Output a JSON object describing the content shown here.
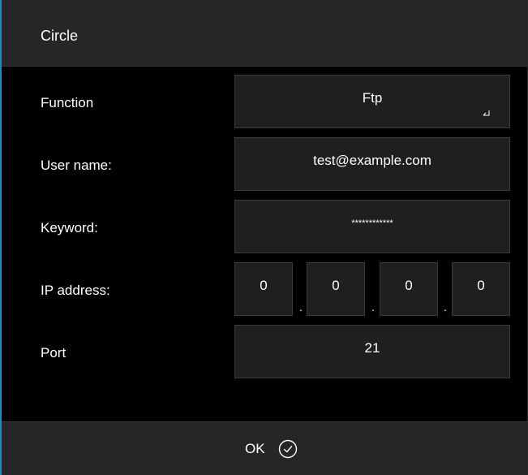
{
  "dialog": {
    "title": "Circle"
  },
  "form": {
    "function": {
      "label": "Function",
      "value": "Ftp",
      "icon": "dropdown-corner-icon"
    },
    "username": {
      "label": "User name:",
      "value": "test@example.com"
    },
    "keyword": {
      "label": "Keyword:",
      "value": "************"
    },
    "ip": {
      "label": "IP address:",
      "octets": [
        "0",
        "0",
        "0",
        "0"
      ],
      "separator": "."
    },
    "port": {
      "label": "Port",
      "value": "21"
    }
  },
  "footer": {
    "ok_label": "OK",
    "ok_icon": "check-circle-icon"
  },
  "colors": {
    "background": "#000000",
    "bar": "#262626",
    "field": "#1f1f1f",
    "field_border": "#3c3c3c",
    "accent_edge": "#1e88c8",
    "text": "#ffffff"
  }
}
